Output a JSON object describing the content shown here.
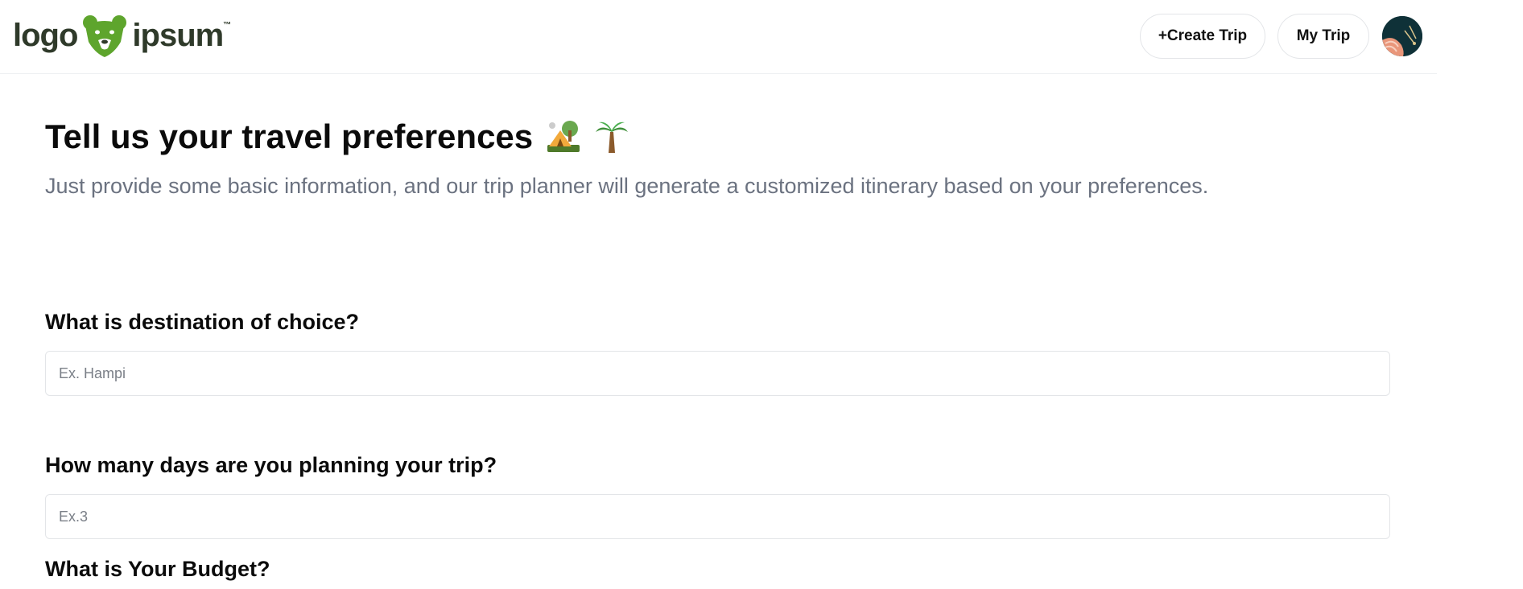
{
  "header": {
    "logo": {
      "text_left": "logo",
      "text_right": "ipsum",
      "mark_icon": "bear-head-icon",
      "brand_color": "#5ea52d",
      "text_color": "#2f3a2a"
    },
    "create_trip_label": "+Create Trip",
    "my_trip_label": "My Trip",
    "avatar_icon": "user-avatar-icon"
  },
  "main": {
    "title": "Tell us your travel preferences",
    "title_icons": [
      "camping-tent-icon",
      "palm-tree-icon"
    ],
    "subtitle": "Just provide some basic information, and our trip planner will generate a customized itinerary based on your preferences."
  },
  "form": {
    "destination": {
      "label": "What is destination of choice?",
      "placeholder": "Ex. Hampi",
      "value": ""
    },
    "days": {
      "label": "How many days are you planning your trip?",
      "placeholder": "Ex.3",
      "value": ""
    },
    "budget": {
      "label": "What is Your Budget?"
    }
  }
}
